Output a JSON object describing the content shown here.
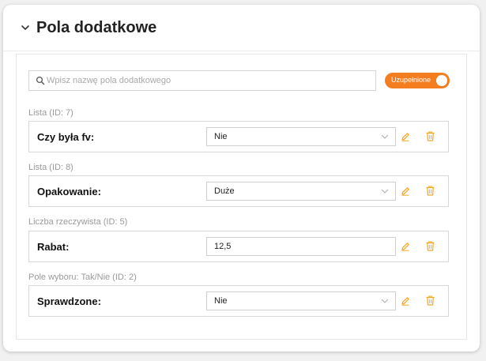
{
  "panel": {
    "title": "Pola dodatkowe",
    "collapse_icon": "chevron-down-icon"
  },
  "search": {
    "placeholder": "Wpisz nazwę pola dodatkowego",
    "value": "",
    "icon": "search-icon"
  },
  "filter_toggle": {
    "label": "Uzupełnione",
    "checked": true
  },
  "fields": [
    {
      "caption": "Lista (ID: 7)",
      "label": "Czy była fv:",
      "control": "select",
      "value": "Nie"
    },
    {
      "caption": "Lista (ID: 8)",
      "label": "Opakowanie:",
      "control": "select",
      "value": "Duże"
    },
    {
      "caption": "Liczba rzeczywista (ID: 5)",
      "label": "Rabat:",
      "control": "input",
      "value": "12,5"
    },
    {
      "caption": "Pole wyboru: Tak/Nie (ID: 2)",
      "label": "Sprawdzone:",
      "control": "select",
      "value": "Nie"
    }
  ],
  "icons": {
    "edit": "pencil-icon",
    "delete": "trash-icon"
  },
  "colors": {
    "accent": "#f47d20",
    "icon": "#f5a623",
    "caption": "#9a9a9a"
  }
}
